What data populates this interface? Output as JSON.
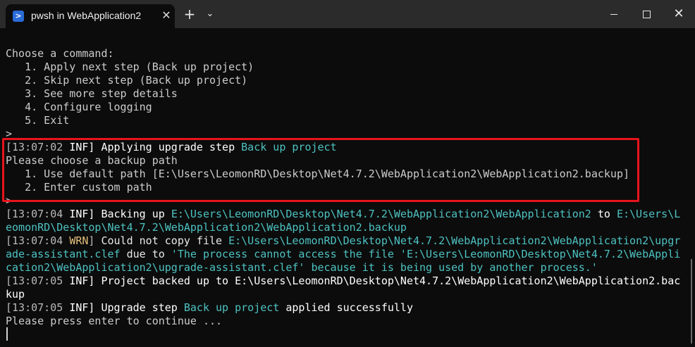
{
  "window": {
    "tab_icon": "powershell-icon",
    "tab_icon_glyph": ">",
    "tab_title": "pwsh in WebApplication2",
    "tab_close": "✕",
    "new_tab": "+",
    "dropdown": "⌄",
    "close": "✕"
  },
  "terminal": {
    "menu_header": "Choose a command:",
    "menu_items": [
      "   1. Apply next step (Back up project)",
      "   2. Skip next step (Back up project)",
      "   3. See more step details",
      "   4. Configure logging",
      "   5. Exit"
    ],
    "prompt": ">",
    "apply_ts": "[13:07:02 ",
    "apply_level": "INF]",
    "apply_text": " Applying upgrade step ",
    "apply_step": "Back up project",
    "backup_prompt": "Please choose a backup path",
    "backup_options": [
      "   1. Use default path [E:\\Users\\LeomonRD\\Desktop\\Net4.7.2\\WebApplication2\\WebApplication2.backup]",
      "   2. Enter custom path"
    ],
    "backing_ts": "[13:07:04 ",
    "backing_level": "INF]",
    "backing_text": " Backing up ",
    "backing_src": "E:\\Users\\LeomonRD\\Desktop\\Net4.7.2\\WebApplication2\\WebApplication2",
    "backing_to": " to ",
    "backing_dst_a": "E:\\Users\\L",
    "backing_dst_b": "eomonRD\\Desktop\\Net4.7.2\\WebApplication2\\WebApplication2.backup",
    "warn_ts": "[13:07:04 ",
    "warn_level": "WRN",
    "warn_close": "]",
    "warn_text": " Could not copy file ",
    "warn_file_a": "E:\\Users\\LeomonRD\\Desktop\\Net4.7.2\\WebApplication2\\WebApplication2\\upgr",
    "warn_file_b": "ade-assistant.clef",
    "warn_due": " due to ",
    "warn_reason_a": "'The process cannot access the file 'E:\\Users\\LeomonRD\\Desktop\\Net4.7.2\\WebAppli",
    "warn_reason_b": "cation2\\WebApplication2\\upgrade-assistant.clef' because it is being used by another process.'",
    "backed_ts": "[13:07:05 ",
    "backed_level": "INF]",
    "backed_text_a": " Project backed up to E:\\Users\\LeomonRD\\Desktop\\Net4.7.2\\WebApplication2\\WebApplication2.bac",
    "backed_text_b": "kup",
    "applied_ts": "[13:07:05 ",
    "applied_level": "INF]",
    "applied_text": " Upgrade step ",
    "applied_step": "Back up project",
    "applied_tail": " applied successfully",
    "continue_prompt": "Please press enter to continue ..."
  },
  "colors": {
    "background": "#0c0c0c",
    "highlight": "#4ec2c2",
    "warning": "#e5c07b",
    "annotation_box": "#e8141c"
  }
}
